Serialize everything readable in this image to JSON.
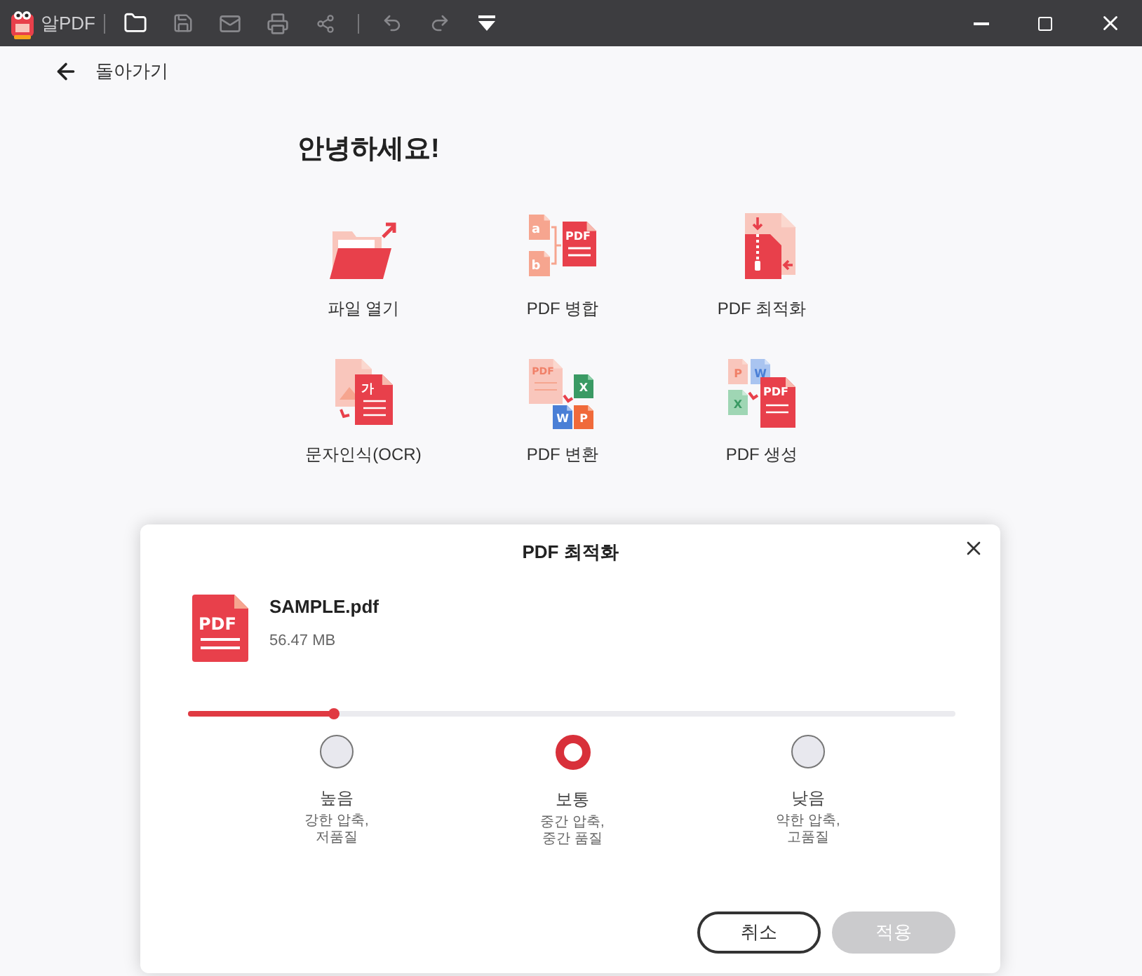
{
  "app": {
    "name": "알PDF"
  },
  "back": {
    "label": "돌아가기"
  },
  "greeting": "안녕하세요!",
  "tools": [
    {
      "kind": "open",
      "label": "파일 열기"
    },
    {
      "kind": "merge",
      "label": "PDF 병합",
      "glyphs": [
        "a",
        "b",
        "PDF"
      ]
    },
    {
      "kind": "optimize",
      "label": "PDF 최적화"
    },
    {
      "kind": "ocr",
      "label": "문자인식(OCR)",
      "glyphs": [
        "가"
      ]
    },
    {
      "kind": "convert",
      "label": "PDF 변환",
      "glyphs": [
        "PDF",
        "X",
        "W",
        "P"
      ]
    },
    {
      "kind": "create",
      "label": "PDF 생성",
      "glyphs": [
        "P",
        "W",
        "X",
        "PDF"
      ]
    }
  ],
  "dialog": {
    "title": "PDF 최적화",
    "file": {
      "badge": "PDF",
      "name": "SAMPLE.pdf",
      "size": "56.47 MB"
    },
    "slider": {
      "level": 0.19
    },
    "options": [
      {
        "label": "높음",
        "lines": [
          "강한 압축,",
          "저품질"
        ],
        "selected": false
      },
      {
        "label": "보통",
        "lines": [
          "중간 압축,",
          "중간 품질"
        ],
        "selected": true
      },
      {
        "label": "낮음",
        "lines": [
          "약한 압축,",
          "고품질"
        ],
        "selected": false
      }
    ],
    "buttons": [
      {
        "label": "취소",
        "disabled": false
      },
      {
        "label": "적용",
        "disabled": true
      }
    ]
  }
}
